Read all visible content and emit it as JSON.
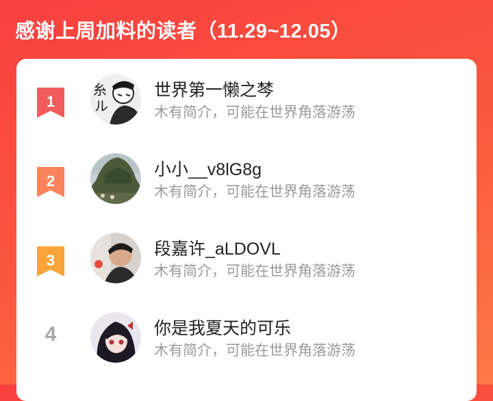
{
  "header": {
    "title": "感谢上周加料的读者（11.29~12.05）"
  },
  "colors": {
    "rank1": "#f25b5b",
    "rank2": "#f7845a",
    "rank3": "#f9a43b",
    "rank_plain": "#a8a8a8",
    "accent": "#f83f3f"
  },
  "readers": [
    {
      "rank": "1",
      "name": "世界第一懒之棽",
      "bio": "木有简介，可能在世界角落游荡"
    },
    {
      "rank": "2",
      "name": "小小__v8lG8g",
      "bio": "木有简介，可能在世界角落游荡"
    },
    {
      "rank": "3",
      "name": "段嘉许_aLDOVL",
      "bio": "木有简介，可能在世界角落游荡"
    },
    {
      "rank": "4",
      "name": "你是我夏天的可乐",
      "bio": "木有简介，可能在世界角落游荡"
    }
  ]
}
